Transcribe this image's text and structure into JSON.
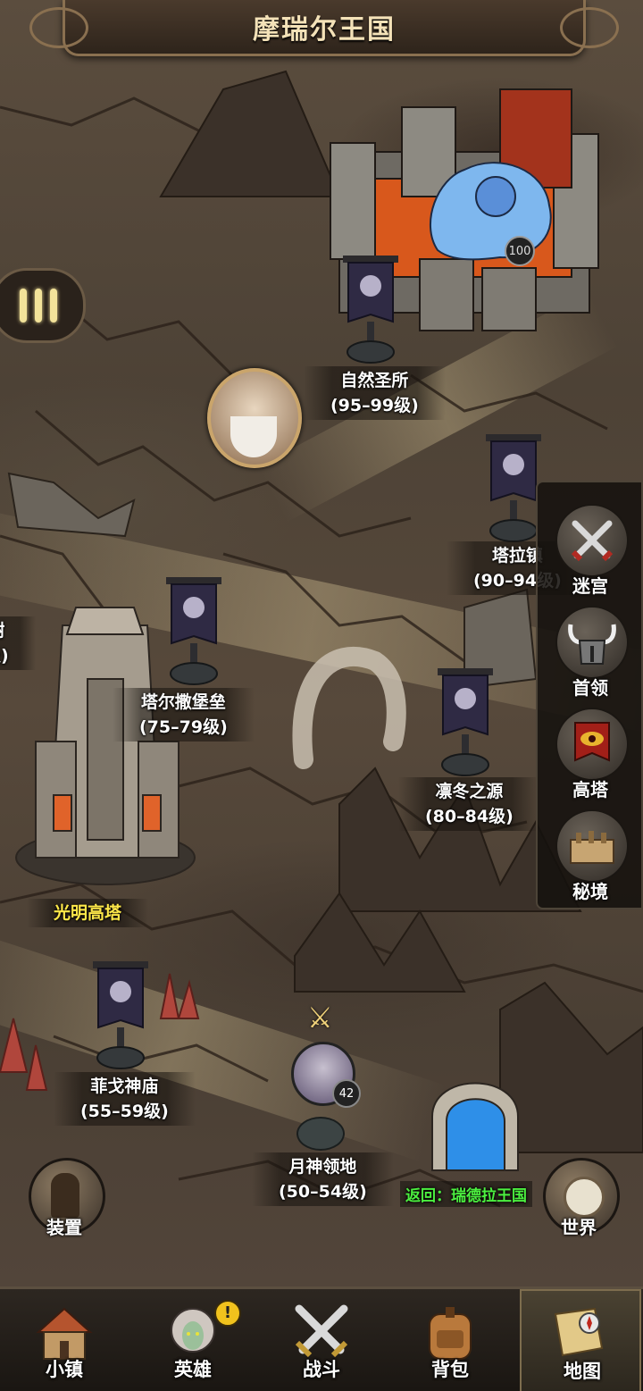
{
  "title": "摩瑞尔王国",
  "boss": {
    "level": "100"
  },
  "player": {
    "level": "42"
  },
  "locations": [
    {
      "key": "natural-sanctuary",
      "name": "自然圣所",
      "levels": "(95–99级)"
    },
    {
      "key": "tala-town",
      "name": "塔拉镇",
      "levels": "(90–94级)"
    },
    {
      "key": "left-edge",
      "name": "树",
      "levels": "级)"
    },
    {
      "key": "tarsa-fortress",
      "name": "塔尔撒堡垒",
      "levels": "(75–79级)"
    },
    {
      "key": "frost-source",
      "name": "凛冬之源",
      "levels": "(80–84级)"
    },
    {
      "key": "phigo-temple",
      "name": "菲戈神庙",
      "levels": "(55–59级)"
    },
    {
      "key": "moon-domain",
      "name": "月神领地",
      "levels": "(50–54级)"
    }
  ],
  "light_tower": "光明高塔",
  "return_portal": "返回：瑞德拉王国",
  "side_panel": [
    {
      "key": "maze",
      "label": "迷宫",
      "icon": "crossed-swords-icon"
    },
    {
      "key": "boss",
      "label": "首领",
      "icon": "horned-helmet-icon"
    },
    {
      "key": "tower",
      "label": "高塔",
      "icon": "eye-banner-icon"
    },
    {
      "key": "secret",
      "label": "秘境",
      "icon": "ruins-icon"
    }
  ],
  "equip_label": "装置",
  "world_label": "世界",
  "bottom_nav": [
    {
      "key": "town",
      "label": "小镇",
      "icon": "town-icon"
    },
    {
      "key": "hero",
      "label": "英雄",
      "icon": "hero-icon",
      "badge": "!"
    },
    {
      "key": "battle",
      "label": "战斗",
      "icon": "battle-icon"
    },
    {
      "key": "bag",
      "label": "背包",
      "icon": "backpack-icon"
    },
    {
      "key": "map",
      "label": "地图",
      "icon": "map-icon",
      "active": true
    }
  ],
  "colors": {
    "accent_yellow": "#f3e39a",
    "portal_green": "#4cf040",
    "tower_label": "#ffe94a"
  }
}
